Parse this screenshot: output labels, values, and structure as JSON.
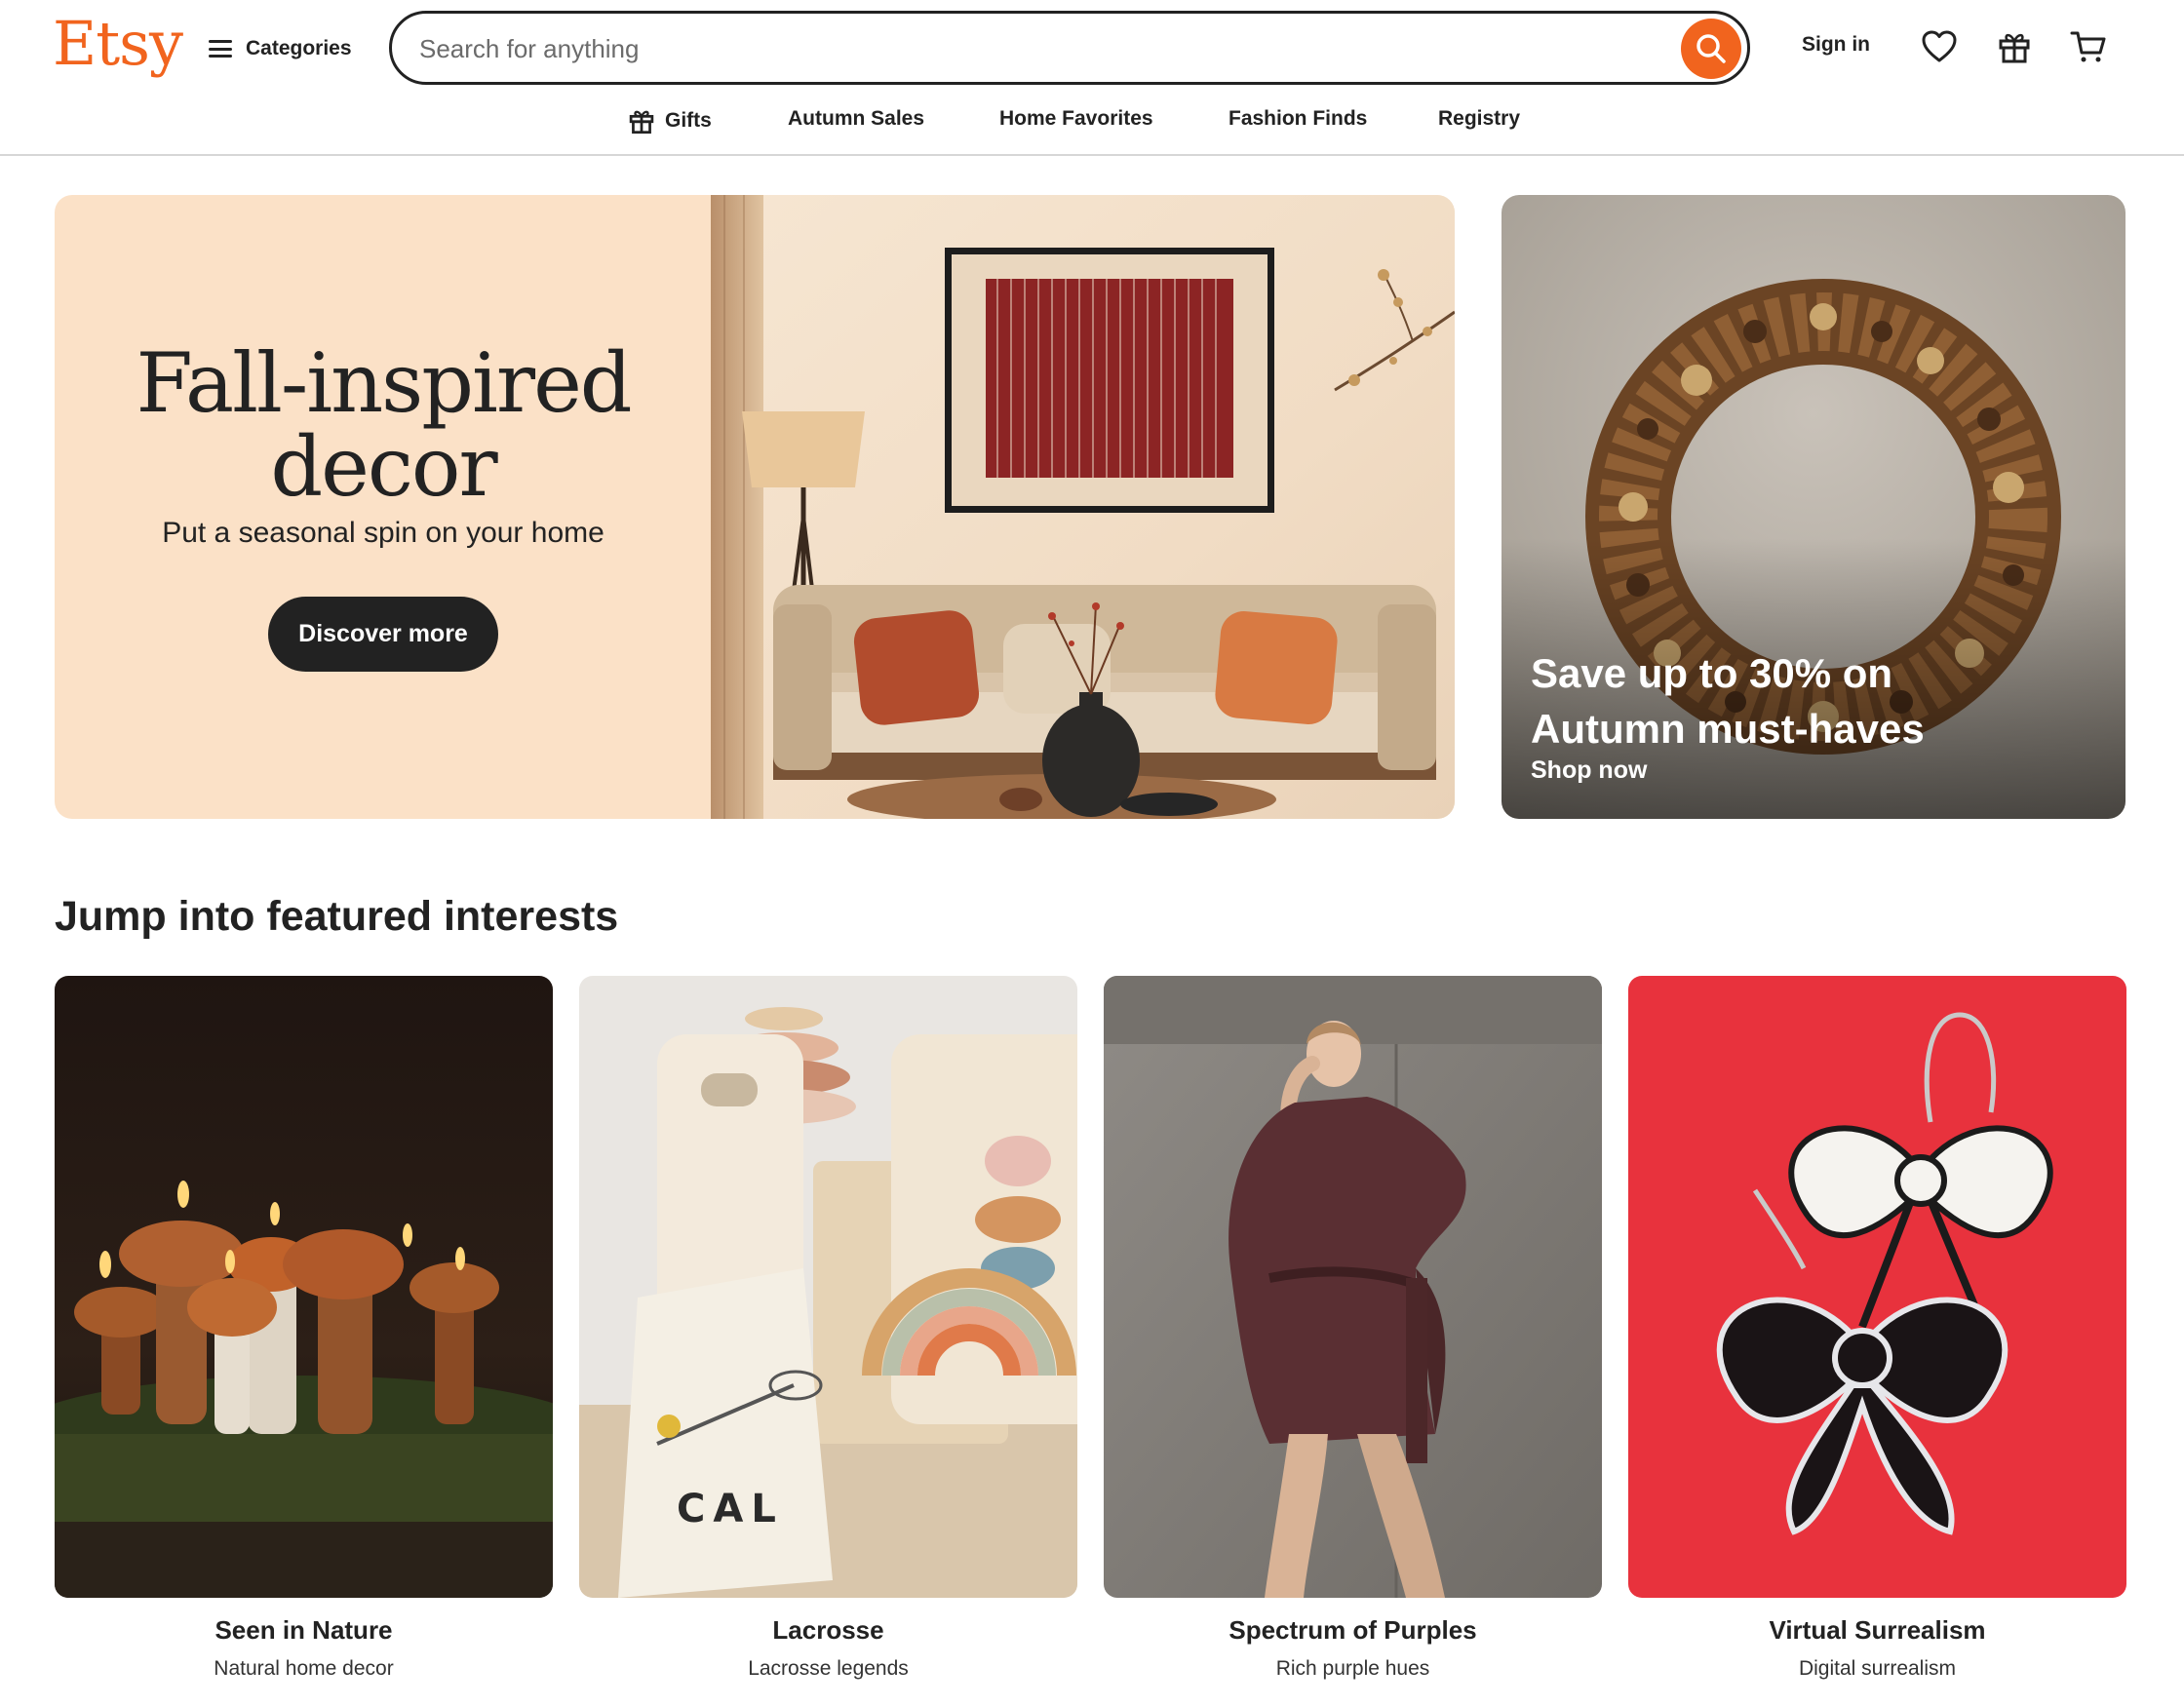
{
  "brand": {
    "logo": "Etsy",
    "accent": "#f1641e"
  },
  "header": {
    "categories_label": "Categories",
    "search_placeholder": "Search for anything",
    "signin_label": "Sign in",
    "icons": [
      "search-icon",
      "heart-icon",
      "gift-icon",
      "cart-icon",
      "menu-icon"
    ]
  },
  "subnav": {
    "items": [
      "Gifts",
      "Autumn Sales",
      "Home Favorites",
      "Fashion Finds",
      "Registry"
    ]
  },
  "hero": {
    "title_line1": "Fall-inspired",
    "title_line2": "decor",
    "subtitle": "Put a seasonal spin on your home",
    "button": "Discover more",
    "background": "#fbe1c7"
  },
  "promo": {
    "title_line1": "Save up to 30% on",
    "title_line2": "Autumn must-haves",
    "cta": "Shop now"
  },
  "featured": {
    "heading": "Jump into featured interests",
    "cards": [
      {
        "title": "Seen in Nature",
        "subtitle": "Natural home decor"
      },
      {
        "title": "Lacrosse",
        "subtitle": "Lacrosse legends"
      },
      {
        "title": "Spectrum of Purples",
        "subtitle": "Rich purple hues"
      },
      {
        "title": "Virtual Surrealism",
        "subtitle": "Digital surrealism"
      }
    ],
    "lacrosse_bag_text": "CAL"
  }
}
